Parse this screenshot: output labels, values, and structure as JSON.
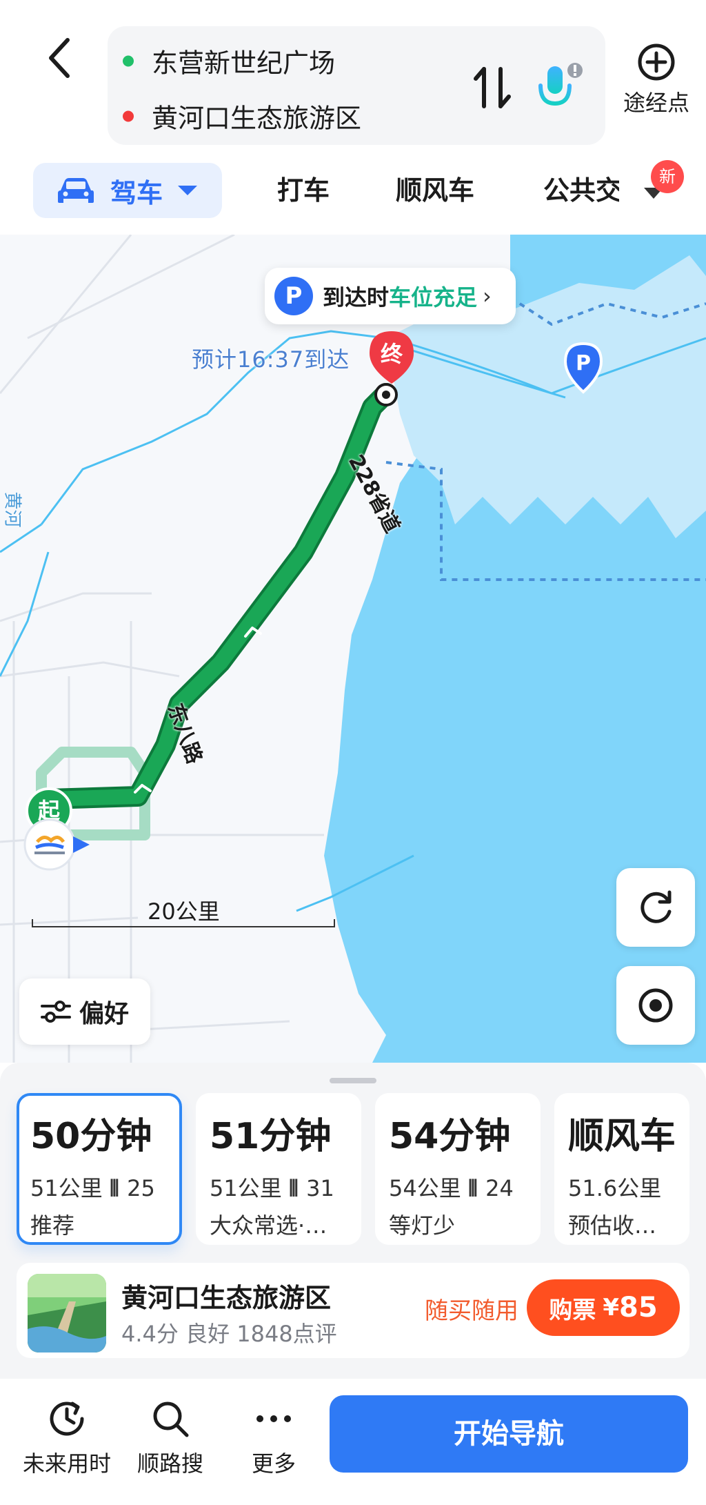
{
  "header": {
    "origin": "东营新世纪广场",
    "destination": "黄河口生态旅游区",
    "waypoint_label": "途经点",
    "icons": [
      "back-icon",
      "swap-icon",
      "mic-icon",
      "add-circle-icon"
    ]
  },
  "modes": {
    "drive": "驾车",
    "taxi": "打车",
    "carpool": "顺风车",
    "transit": "公共交",
    "new_badge": "新"
  },
  "map": {
    "parking_prefix": "到达时",
    "parking_status": "车位充足",
    "parking_symbol": "P",
    "eta": "预计16:37到达",
    "end_marker": "终",
    "start_marker": "起",
    "road_provincial": "228省道",
    "road_dongba": "东八路",
    "river_label": "黄河",
    "scale_label": "20公里",
    "preference_label": "偏好",
    "colors": {
      "route": "#1aa756",
      "sea": "#80d5fa",
      "accent": "#2f6ff5"
    }
  },
  "routes": [
    {
      "time": "50分钟",
      "distance": "51公里",
      "lights": "25",
      "tag": "推荐",
      "selected": true
    },
    {
      "time": "51分钟",
      "distance": "51公里",
      "lights": "31",
      "tag": "大众常选·灯多",
      "selected": false
    },
    {
      "time": "54分钟",
      "distance": "54公里",
      "lights": "24",
      "tag": "等灯少",
      "selected": false
    },
    {
      "time": "顺风车",
      "distance": "51.6公里",
      "lights": "",
      "tag": "预估收入¥...",
      "selected": false
    }
  ],
  "poi": {
    "name": "黄河口生态旅游区",
    "meta": "4.4分  良好  1848点评",
    "promo": "随买随用",
    "buy_label": "购票",
    "currency": "¥",
    "price": "85"
  },
  "bottom": {
    "future_time": "未来用时",
    "along_search": "顺路搜",
    "more": "更多",
    "start_nav": "开始导航"
  }
}
